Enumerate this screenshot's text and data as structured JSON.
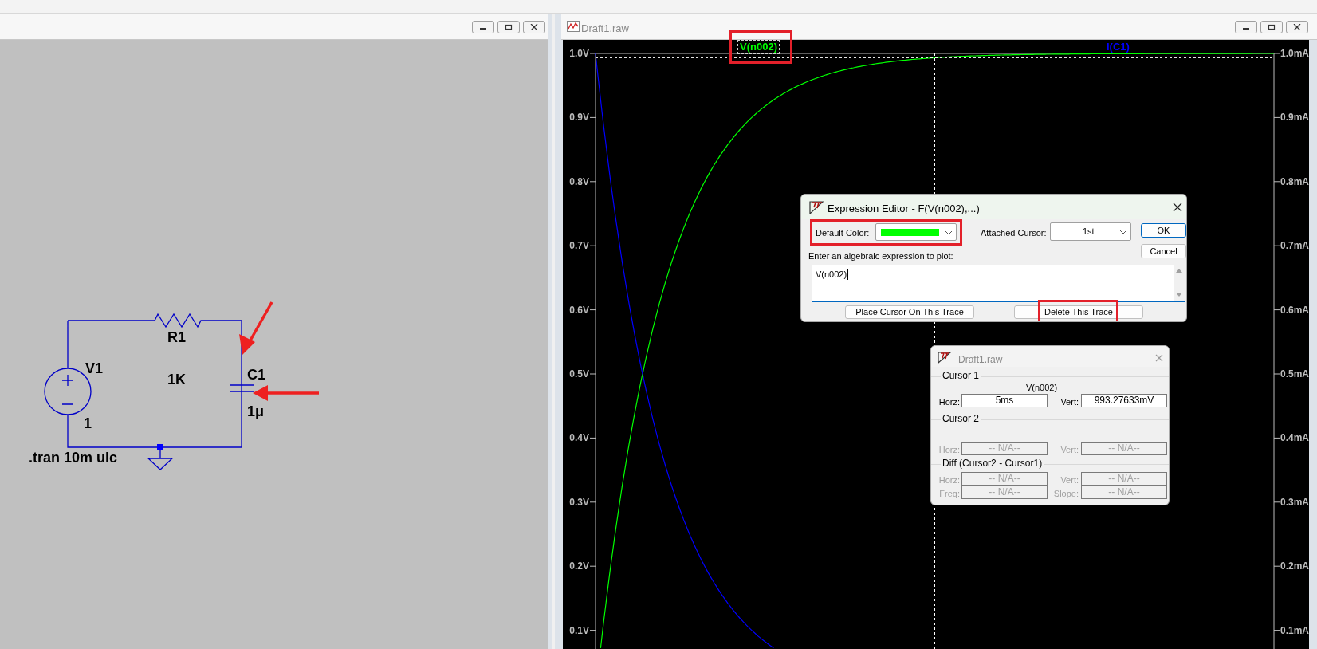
{
  "schematic": {
    "components": [
      {
        "name": "R1",
        "value": "1K"
      },
      {
        "name": "V1",
        "value": "1"
      },
      {
        "name": "C1",
        "value": "1μ"
      }
    ],
    "directive": ".tran 10m uic"
  },
  "plot_window": {
    "title": "Draft1.raw"
  },
  "plot": {
    "traces": [
      {
        "label": "V(n002)",
        "color": "#00ff00",
        "kind": "rise",
        "selected": true,
        "annotated": true
      },
      {
        "label": "I(C1)",
        "color": "#0000ff",
        "kind": "decay",
        "selected": false,
        "annotated": false
      }
    ],
    "left_ticks": [
      "1.0V",
      "0.9V",
      "0.8V",
      "0.7V",
      "0.6V",
      "0.5V",
      "0.4V",
      "0.3V",
      "0.2V",
      "0.1V"
    ],
    "right_ticks": [
      "1.0mA",
      "0.9mA",
      "0.8mA",
      "0.7mA",
      "0.6mA",
      "0.5mA",
      "0.4mA",
      "0.3mA",
      "0.2mA",
      "0.1mA"
    ]
  },
  "expression_editor": {
    "title": "Expression Editor - F(V(n002),...)",
    "default_color_label": "Default Color:",
    "color_swatch": {
      "color": "#00ff00"
    },
    "color_annotated": true,
    "attached_cursor_label": "Attached Cursor:",
    "attached_cursor": "1st",
    "ok": "OK",
    "cancel": "Cancel",
    "prompt": "Enter an algebraic expression to plot:",
    "expression": "V(n002)",
    "actions": [
      {
        "label": "Place Cursor On This Trace",
        "annotated": false
      },
      {
        "label": "Delete This Trace",
        "annotated": true
      }
    ]
  },
  "cursor_dialog": {
    "title": "Draft1.raw",
    "groups": [
      {
        "title": "Cursor 1",
        "trace": "V(n002)",
        "disabled": false,
        "fields": [
          {
            "label": "Horz:",
            "value": "5ms"
          },
          {
            "label": "Vert:",
            "value": "993.27633mV"
          }
        ]
      },
      {
        "title": "Cursor 2",
        "disabled": true,
        "fields": [
          {
            "label": "Horz:",
            "value": "-- N/A--"
          },
          {
            "label": "Vert:",
            "value": "-- N/A--"
          }
        ]
      },
      {
        "title": "Diff (Cursor2 - Cursor1)",
        "disabled": true,
        "fields": [
          {
            "label": "Horz:",
            "value": "-- N/A--"
          },
          {
            "label": "Vert:",
            "value": "-- N/A--"
          },
          {
            "label": "Freq:",
            "value": "-- N/A--"
          },
          {
            "label": "Slope:",
            "value": "-- N/A--"
          }
        ]
      }
    ]
  }
}
